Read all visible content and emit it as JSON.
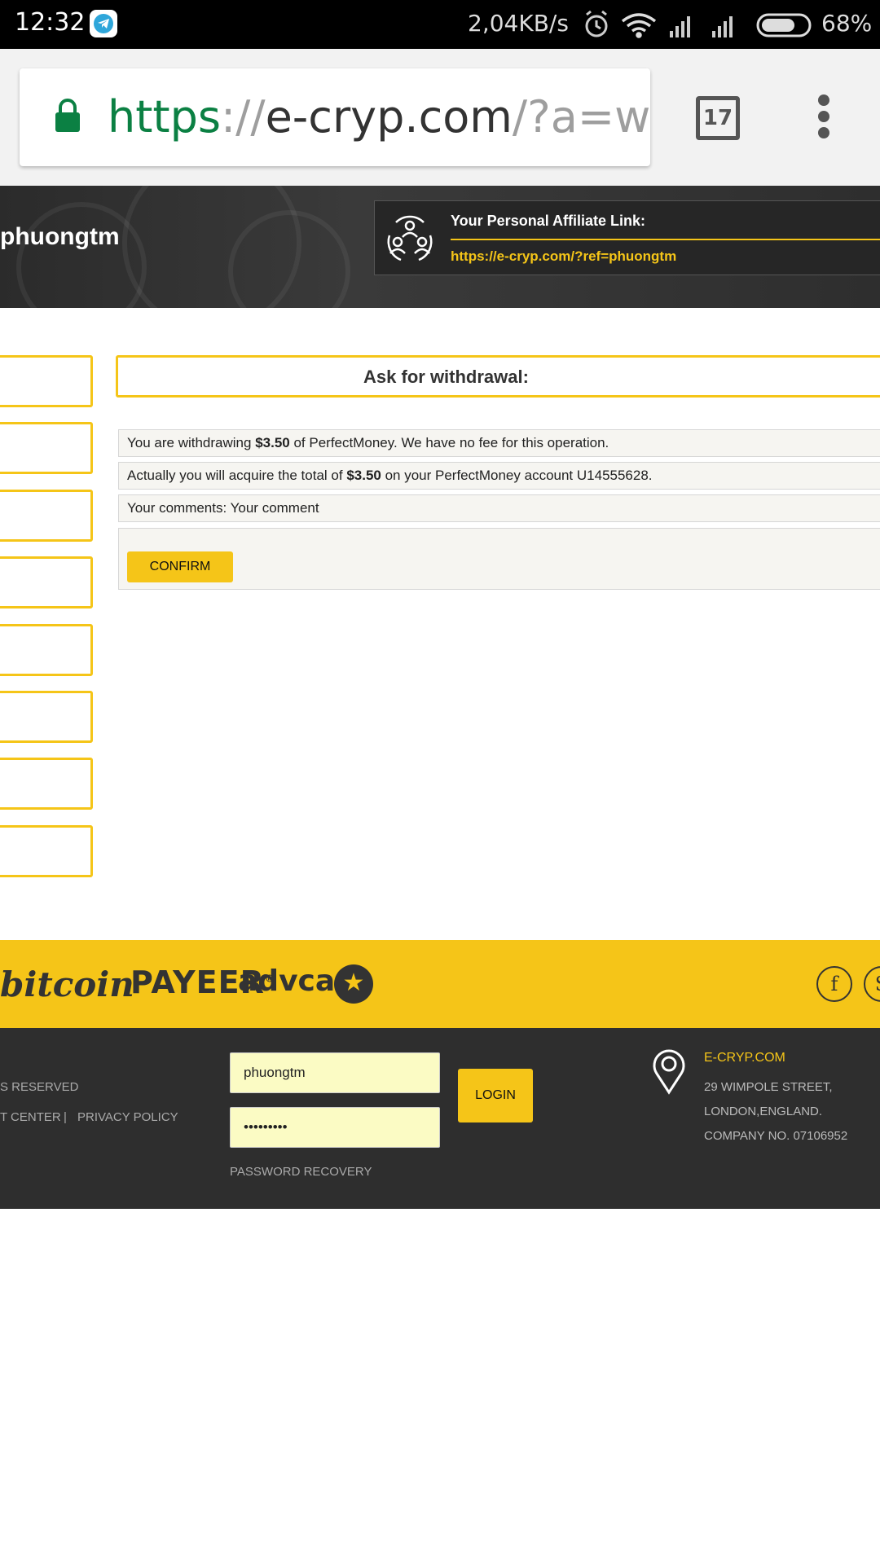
{
  "status_bar": {
    "time": "12:32",
    "net_speed": "2,04KB/s",
    "battery": "68%"
  },
  "browser": {
    "url_scheme": "https",
    "url_sep": "://",
    "url_host": "e-cryp.com",
    "url_path": "/?a=witl",
    "tab_count": "17"
  },
  "hero": {
    "username": "phuongtm",
    "affiliate_title": "Your Personal Affiliate Link:",
    "affiliate_link": "https://e-cryp.com/?ref=phuongtm"
  },
  "main": {
    "header": "Ask for withdrawal:",
    "row1": {
      "pre": "You are withdrawing ",
      "amount": "$3.50",
      "post": " of PerfectMoney. We have no fee for this operation."
    },
    "row2": {
      "pre": "Actually you will acquire the total of ",
      "amount": "$3.50",
      "post": " on your PerfectMoney account U14555628."
    },
    "row3": "Your comments: Your comment",
    "confirm": "CONFIRM"
  },
  "footer": {
    "brands": {
      "bitcoin": "bitcoin",
      "payeer": "PAYEER",
      "payeer_reg": "®",
      "advcash": "advcash"
    },
    "rights": "S RESERVED",
    "links": {
      "support": "T CENTER",
      "divider": "|",
      "privacy": "PRIVACY POLICY"
    },
    "login": {
      "username": "phuongtm",
      "password": "•••••••••",
      "button": "LOGIN",
      "recovery": "PASSWORD RECOVERY"
    },
    "address": {
      "title": "E-CRYP.COM",
      "line1": "29 WIMPOLE STREET,",
      "line2": "LONDON,ENGLAND.",
      "line3": "COMPANY NO. 07106952"
    }
  },
  "colors": {
    "accent": "#f5c518",
    "dark": "#2e2e2e"
  }
}
